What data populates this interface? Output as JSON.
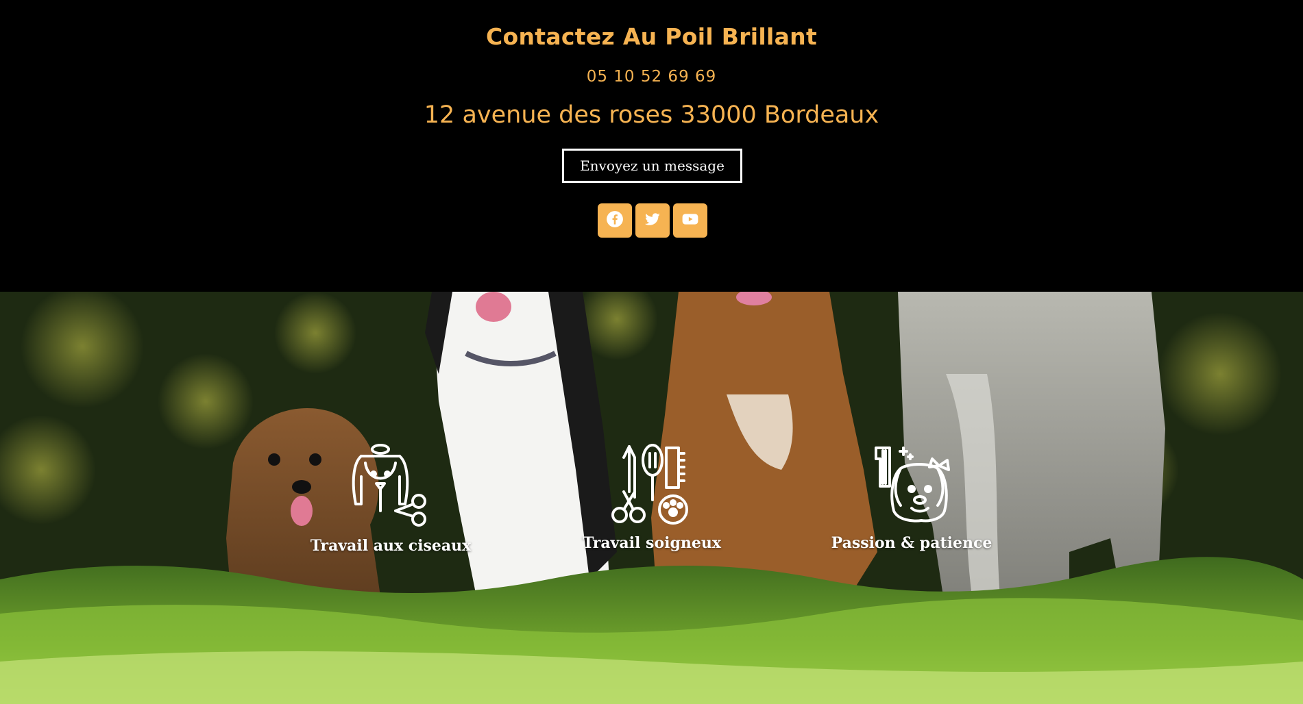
{
  "contact": {
    "title": "Contactez Au Poil Brillant",
    "phone": "05 10 52 69 69",
    "address": "12 avenue des roses 33000 Bordeaux",
    "message_button": "Envoyez un message"
  },
  "social": [
    {
      "icon": "facebook-icon"
    },
    {
      "icon": "twitter-icon"
    },
    {
      "icon": "youtube-icon"
    }
  ],
  "features": [
    {
      "label": "Travail aux ciseaux",
      "icon": "dog-grooming-scissors-icon"
    },
    {
      "label": "Travail soigneux",
      "icon": "grooming-tools-icon"
    },
    {
      "label": "Passion & patience",
      "icon": "dog-comb-sparkle-icon"
    }
  ],
  "colors": {
    "accent": "#f6b352",
    "background": "#000000",
    "text_light": "#ffffff"
  }
}
